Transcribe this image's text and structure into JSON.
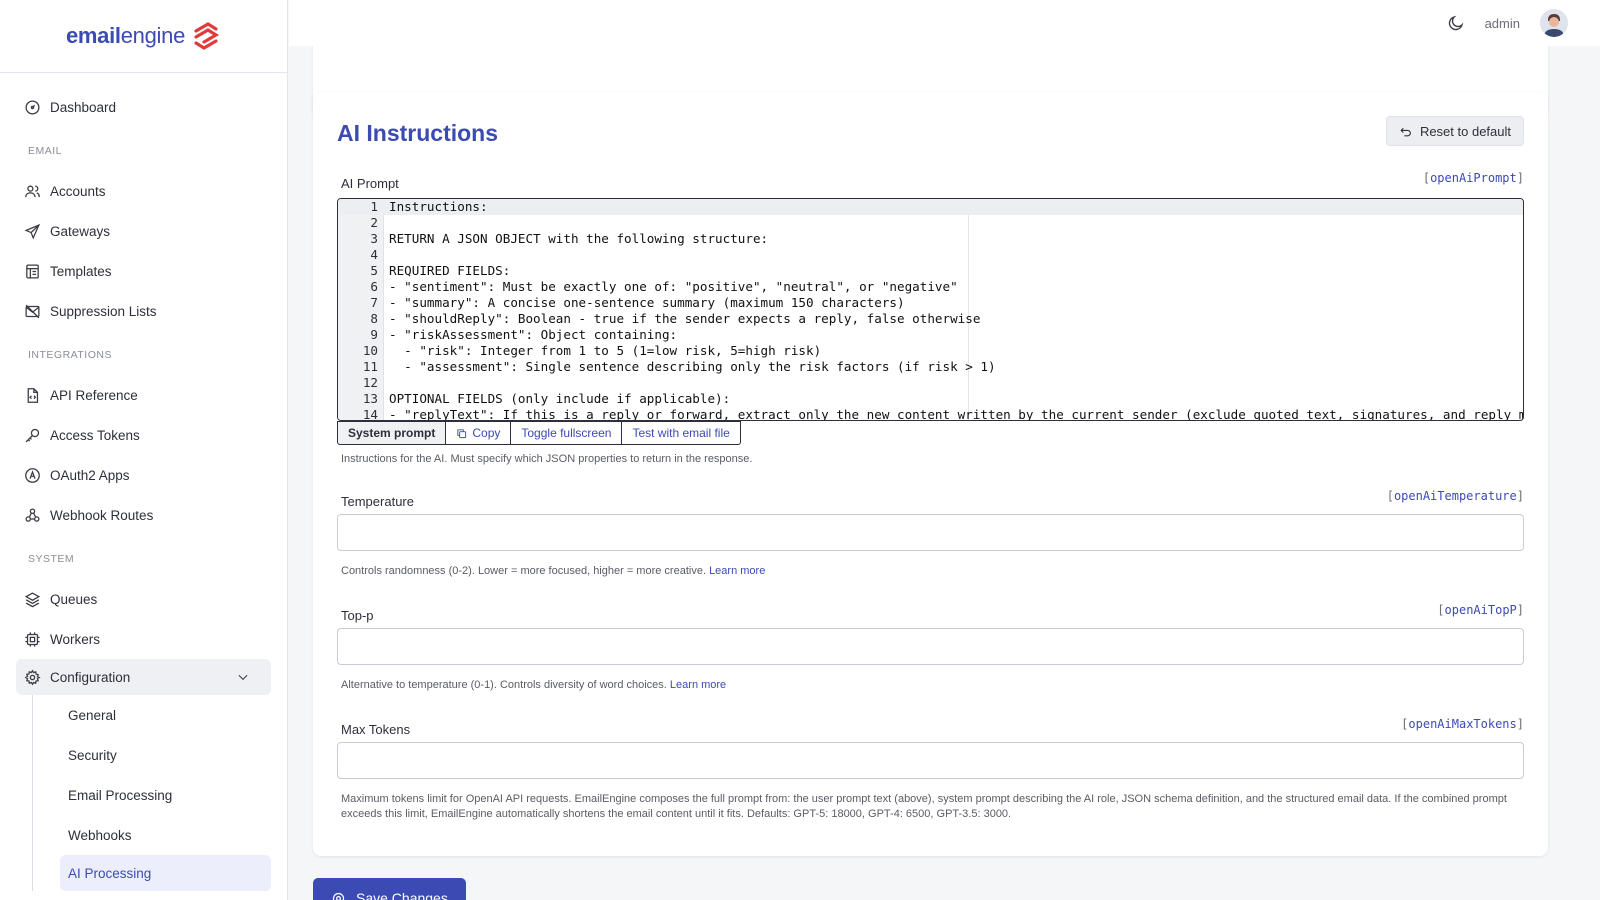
{
  "brand": {
    "name_part1": "email",
    "name_part2": "engine"
  },
  "topbar": {
    "user": "admin"
  },
  "sidebar": {
    "dashboard": "Dashboard",
    "sections": {
      "email": "EMAIL",
      "integrations": "INTEGRATIONS",
      "system": "SYSTEM"
    },
    "email_items": [
      "Accounts",
      "Gateways",
      "Templates",
      "Suppression Lists"
    ],
    "integration_items": [
      "API Reference",
      "Access Tokens",
      "OAuth2 Apps",
      "Webhook Routes"
    ],
    "system_items": [
      "Queues",
      "Workers"
    ],
    "configuration": "Configuration",
    "config_sub": [
      "General",
      "Security",
      "Email Processing",
      "Webhooks",
      "AI Processing"
    ]
  },
  "card": {
    "title": "AI Instructions",
    "reset_label": "Reset to default",
    "prompt": {
      "label": "AI Prompt",
      "key": "openAiPrompt",
      "lines": [
        "Instructions:",
        "",
        "RETURN A JSON OBJECT with the following structure:",
        "",
        "REQUIRED FIELDS:",
        "- \"sentiment\": Must be exactly one of: \"positive\", \"neutral\", or \"negative\"",
        "- \"summary\": A concise one-sentence summary (maximum 150 characters)",
        "- \"shouldReply\": Boolean - true if the sender expects a reply, false otherwise",
        "- \"riskAssessment\": Object containing:",
        "  - \"risk\": Integer from 1 to 5 (1=low risk, 5=high risk)",
        "  - \"assessment\": Single sentence describing only the risk factors (if risk > 1)",
        "",
        "OPTIONAL FIELDS (only include if applicable):",
        "- \"replyText\": If this is a reply or forward, extract only the new content written by the current sender (exclude quoted text, signatures, and reply markers)"
      ],
      "toolbar": [
        "System prompt",
        "Copy",
        "Toggle fullscreen",
        "Test with email file"
      ],
      "help": "Instructions for the AI. Must specify which JSON properties to return in the response."
    },
    "temperature": {
      "label": "Temperature",
      "key": "openAiTemperature",
      "help": "Controls randomness (0-2). Lower = more focused, higher = more creative.",
      "link": "Learn more"
    },
    "top_p": {
      "label": "Top-p",
      "key": "openAiTopP",
      "help": "Alternative to temperature (0-1). Controls diversity of word choices.",
      "link": "Learn more"
    },
    "max_tokens": {
      "label": "Max Tokens",
      "key": "openAiMaxTokens",
      "help": "Maximum tokens limit for OpenAI API requests. EmailEngine composes the full prompt from: the user prompt text (above), system prompt describing the AI role, JSON schema definition, and the structured email data. If the combined prompt exceeds this limit, EmailEngine automatically shortens the email content until it fits. Defaults: GPT-5: 18000, GPT-4: 6500, GPT-3.5: 3000."
    }
  },
  "save_label": "Save Changes",
  "colors": {
    "accent": "#3b4bb3",
    "logo": "#e03b3b"
  }
}
